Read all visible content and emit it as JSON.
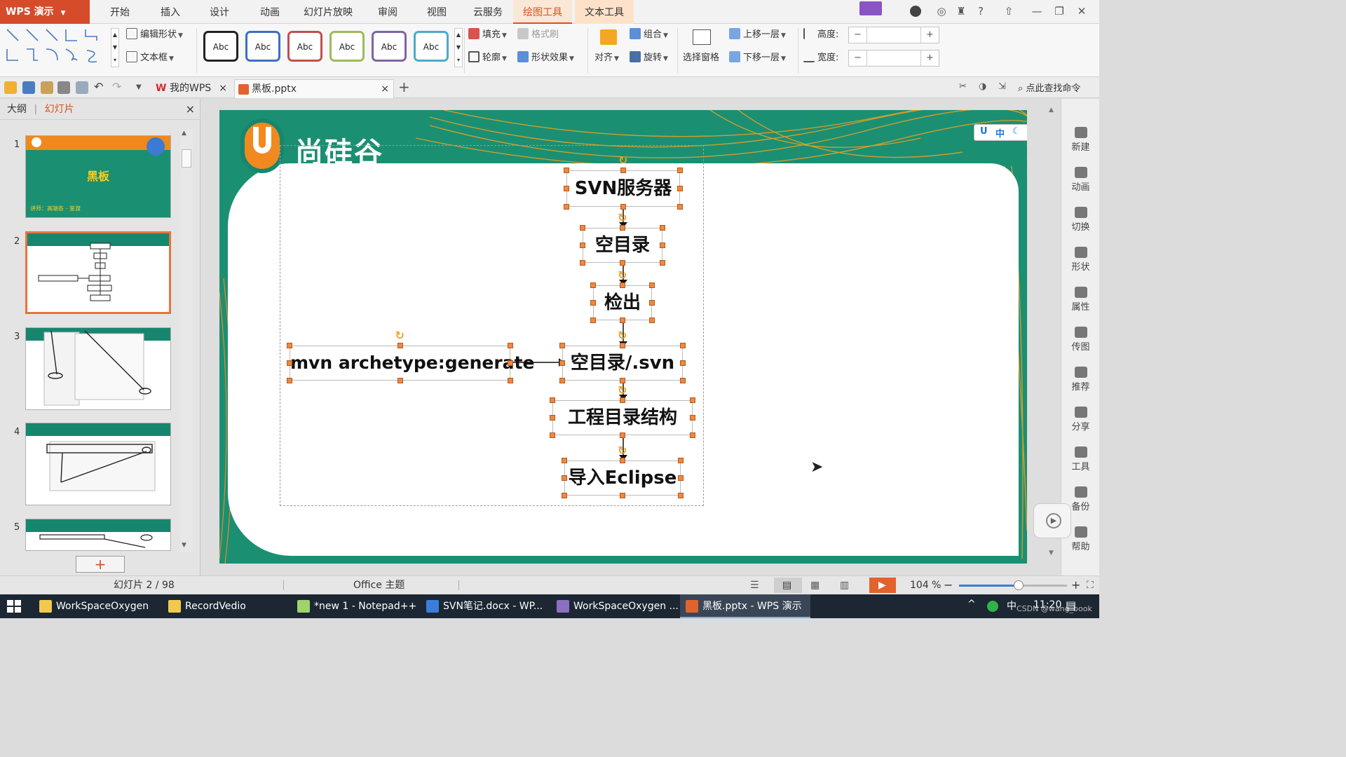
{
  "app": {
    "logo": "WPS 演示"
  },
  "ribbon_tabs": [
    "开始",
    "插入",
    "设计",
    "动画",
    "幻灯片放映",
    "审阅",
    "视图",
    "云服务",
    "绘图工具",
    "文本工具"
  ],
  "active_tab": "绘图工具",
  "ribbon": {
    "edit_shape": "编辑形状",
    "text_box": "文本框",
    "style_label": "Abc",
    "style_colors": [
      "#222222",
      "#3d6fbf",
      "#c0504d",
      "#9bbb59",
      "#8064a2",
      "#4bacc6"
    ],
    "fill": "填充",
    "format_painter": "格式刷",
    "outline": "轮廓",
    "shape_effect": "形状效果",
    "align": "对齐",
    "group": "组合",
    "rotate": "旋转",
    "selection_pane": "选择窗格",
    "bring_forward": "上移一层",
    "send_backward": "下移一层",
    "height": "高度:",
    "width": "宽度:",
    "minus": "−",
    "plus": "+"
  },
  "doc_tabs": [
    {
      "label": "我的WPS",
      "close": "×"
    },
    {
      "label": "黑板.pptx",
      "close": "×"
    }
  ],
  "new_tab": "+",
  "search_cmd": "点此查找命令",
  "left_pane": {
    "outline": "大纲",
    "slides": "幻灯片",
    "close": "×",
    "add": "+"
  },
  "thumbnails": [
    {
      "num": "1",
      "title": "黑板",
      "sub": "讲师：高端各 - 鉴渡"
    },
    {
      "num": "2"
    },
    {
      "num": "3"
    },
    {
      "num": "4"
    },
    {
      "num": "5"
    }
  ],
  "slide": {
    "logo_text": "尚硅谷",
    "nodes": {
      "svn_server": "SVN服务器",
      "empty_dir": "空目录",
      "checkout": "检出",
      "mvn": "mvn archetype:generate",
      "empty_svn": "空目录/.svn",
      "project_structure": "工程目录结构",
      "import_eclipse": "导入Eclipse"
    }
  },
  "ime_bar": "中",
  "right_sidebar": [
    "新建",
    "动画",
    "切换",
    "形状",
    "属性",
    "传图",
    "推荐",
    "分享",
    "工具",
    "备份",
    "帮助"
  ],
  "status": {
    "slide": "幻灯片 2 / 98",
    "theme": "Office 主题",
    "zoom": "104 %",
    "zoom_level": 0.55
  },
  "taskbar": [
    {
      "label": "WorkSpaceOxygen",
      "color": "#f2c94c"
    },
    {
      "label": "RecordVedio",
      "color": "#f2c94c"
    },
    {
      "label": "*new 1 - Notepad++",
      "color": "#9fd36b"
    },
    {
      "label": "SVN笔记.docx - WP...",
      "color": "#3b7ddd"
    },
    {
      "label": "WorkSpaceOxygen ...",
      "color": "#8a6fc2"
    },
    {
      "label": "黑板.pptx - WPS 演示",
      "color": "#e0632e"
    }
  ],
  "tray": {
    "ime": "中",
    "time": "11:20",
    "watermark": "CSDN @wang_book"
  }
}
